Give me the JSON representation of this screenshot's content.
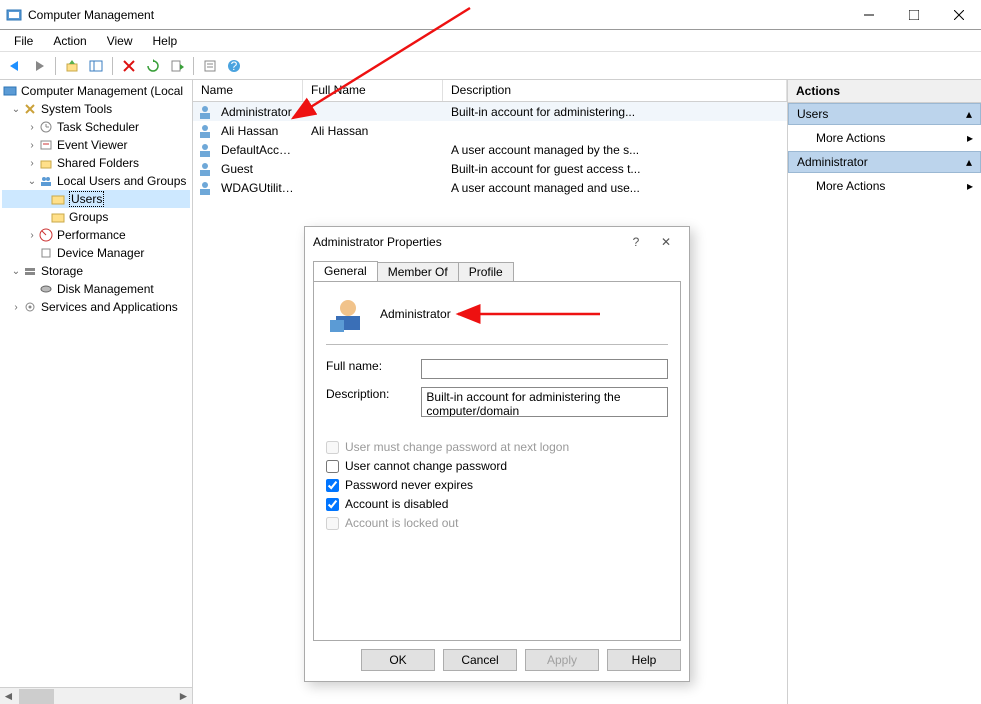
{
  "window": {
    "title": "Computer Management"
  },
  "menu": {
    "file": "File",
    "action": "Action",
    "view": "View",
    "help": "Help"
  },
  "tree": {
    "root": "Computer Management (Local",
    "systools": "System Tools",
    "task": "Task Scheduler",
    "event": "Event Viewer",
    "shared": "Shared Folders",
    "lug": "Local Users and Groups",
    "users": "Users",
    "groups": "Groups",
    "perf": "Performance",
    "devmgr": "Device Manager",
    "storage": "Storage",
    "diskmgmt": "Disk Management",
    "services": "Services and Applications"
  },
  "list": {
    "cols": {
      "name": "Name",
      "fullname": "Full Name",
      "desc": "Description"
    },
    "rows": [
      {
        "name": "Administrator",
        "fullname": "",
        "desc": "Built-in account for administering..."
      },
      {
        "name": "Ali Hassan",
        "fullname": "Ali Hassan",
        "desc": ""
      },
      {
        "name": "DefaultAcco...",
        "fullname": "",
        "desc": "A user account managed by the s..."
      },
      {
        "name": "Guest",
        "fullname": "",
        "desc": "Built-in account for guest access t..."
      },
      {
        "name": "WDAGUtility...",
        "fullname": "",
        "desc": "A user account managed and use..."
      }
    ]
  },
  "actions": {
    "header": "Actions",
    "sec1": "Users",
    "more": "More Actions",
    "sec2": "Administrator"
  },
  "dialog": {
    "title": "Administrator Properties",
    "tabs": {
      "general": "General",
      "memberof": "Member Of",
      "profile": "Profile"
    },
    "username": "Administrator",
    "fullname_lbl": "Full name:",
    "fullname_val": "",
    "desc_lbl": "Description:",
    "desc_val": "Built-in account for administering the computer/domain",
    "chk_mustchange": "User must change password at next logon",
    "chk_cannotchange": "User cannot change password",
    "chk_neverexp": "Password never expires",
    "chk_disabled": "Account is disabled",
    "chk_locked": "Account is locked out",
    "btn_ok": "OK",
    "btn_cancel": "Cancel",
    "btn_apply": "Apply",
    "btn_help": "Help"
  }
}
